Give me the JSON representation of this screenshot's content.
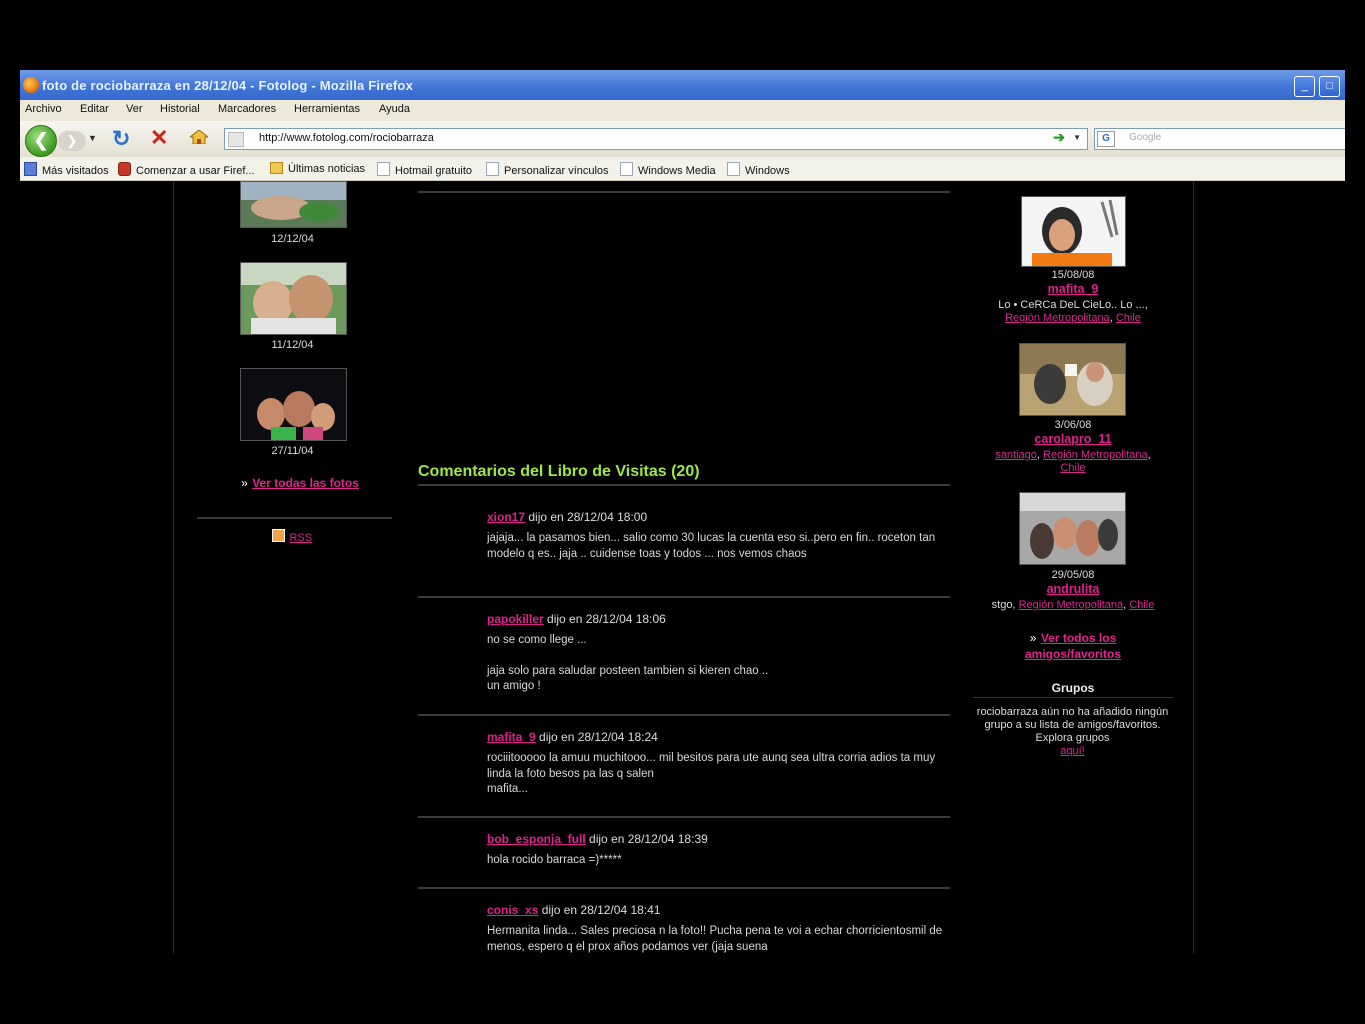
{
  "window": {
    "title": "foto de rociobarraza en 28/12/04 - Fotolog - Mozilla Firefox"
  },
  "menu": [
    "Archivo",
    "Editar",
    "Ver",
    "Historial",
    "Marcadores",
    "Herramientas",
    "Ayuda"
  ],
  "toolbar": {
    "url": "http://www.fotolog.com/rociobarraza",
    "search_placeholder": "Google"
  },
  "bookmarks": [
    "Más visitados",
    "Comenzar a usar Firef...",
    "Últimas noticias",
    "Hotmail gratuito",
    "Personalizar vínculos",
    "Windows Media",
    "Windows"
  ],
  "left": {
    "dates": [
      "12/12/04",
      "11/12/04",
      "27/11/04"
    ],
    "see_all_photos": "Ver todas las fotos",
    "rss": "RSS",
    "arrow": "»"
  },
  "guestbook": {
    "title": "Comentarios del Libro de Visitas (20)",
    "comments": [
      {
        "user": "xion17",
        "meta": " dijo en 28/12/04 18:00",
        "body": [
          "jajaja... la pasamos bien... salio como 30 lucas la cuenta eso si..pero en fin.. roceton tan modelo q es.. jaja .. cuidense toas y todos ... nos vemos chaos"
        ]
      },
      {
        "user": "papokiller",
        "meta": " dijo en 28/12/04 18:06",
        "body": [
          "no se como llege ...",
          "",
          "jaja solo para saludar posteen tambien si kieren chao ..",
          "un amigo !"
        ]
      },
      {
        "user": "mafita_9",
        "meta": " dijo en 28/12/04 18:24",
        "body": [
          "rociiitooooo la amuu muchitooo... mil besitos para ute aunq sea ultra corria adios ta muy linda la foto besos pa las q salen",
          "mafita..."
        ]
      },
      {
        "user": "bob_esponja_full",
        "meta": " dijo en 28/12/04 18:39",
        "body": [
          "hola rocido barraca =)*****"
        ]
      },
      {
        "user": "conis_xs",
        "meta": " dijo en 28/12/04 18:41",
        "body": [
          "Hermanita linda... Sales preciosa n la foto!! Pucha pena te voi a echar chorricientosmil de menos, espero q el prox años podamos ver (jaja suena"
        ]
      }
    ]
  },
  "friends": [
    {
      "date": "15/08/08",
      "name": "mafita_9",
      "loc_text": "Lo • CeRCa DeL CieLo.. Lo ...,",
      "loc_links": [
        "Región Metropolitana",
        "Chile"
      ]
    },
    {
      "date": "3/06/08",
      "name": "carolapro_11",
      "loc_links": [
        "santiago",
        "Región Metropolitana",
        "Chile"
      ]
    },
    {
      "date": "29/05/08",
      "name": "andrulita",
      "loc_text": "stgo,",
      "loc_links": [
        "Región Metropolitana",
        "Chile"
      ]
    }
  ],
  "friends_all": "Ver todos los amigos/favoritos",
  "groups": {
    "title": "Grupos",
    "text": "rociobarraza aún no ha añadido ningún grupo a su lista de amigos/favoritos. Explora grupos",
    "link": "aquí!"
  },
  "colors": {
    "accent_pink": "#e0208e",
    "accent_green": "#9fe843",
    "background": "#000000"
  }
}
